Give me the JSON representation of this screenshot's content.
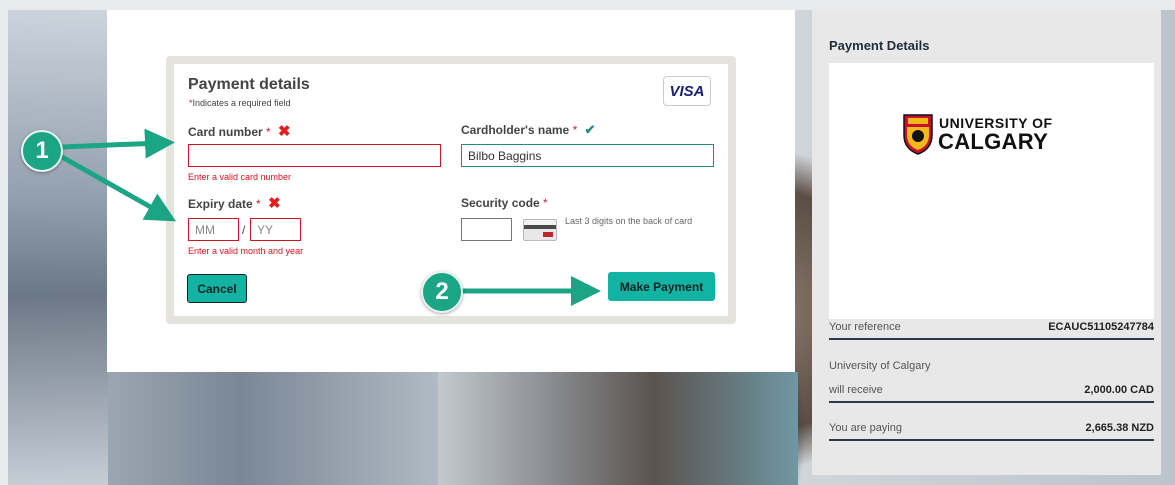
{
  "form": {
    "title": "Payment details",
    "required_star": "*",
    "required_note": "Indicates a required field",
    "card_brand": "VISA",
    "card_number": {
      "label": "Card number",
      "star": "*",
      "value": "",
      "error": "Enter a valid card number"
    },
    "cardholder": {
      "label": "Cardholder's name",
      "star": "*",
      "value": "Bilbo Baggins"
    },
    "expiry": {
      "label": "Expiry date",
      "star": "*",
      "month_placeholder": "MM",
      "year_placeholder": "YY",
      "separator": "/",
      "error": "Enter a valid month and year"
    },
    "security": {
      "label": "Security code",
      "star": "*",
      "value": "",
      "hint": "Last 3 digits on the back of card"
    },
    "cancel_label": "Cancel",
    "pay_label": "Make Payment",
    "error_icon": "x-icon",
    "valid_icon": "check-icon"
  },
  "callouts": {
    "one": "1",
    "two": "2"
  },
  "summary": {
    "title": "Payment Details",
    "logo_top": "UNIVERSITY OF",
    "logo_bottom": "CALGARY",
    "reference_label": "Your reference",
    "reference_value": "ECAUC51105247784",
    "payee_line1": "University of Calgary",
    "payee_line2": "will receive",
    "receive_value": "2,000.00 CAD",
    "paying_label": "You are paying",
    "paying_value": "2,665.38 NZD"
  },
  "colors": {
    "accent": "#13b3a3",
    "error": "#d0161f",
    "annotation": "#1ba585"
  }
}
